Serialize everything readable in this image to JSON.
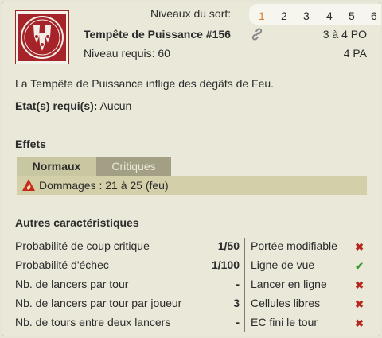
{
  "header": {
    "levels_label": "Niveaux du sort:",
    "levels": [
      "1",
      "2",
      "3",
      "4",
      "5",
      "6"
    ],
    "active_level": "1",
    "spell_name": "Tempête de Puissance #156",
    "range": "3 à 4 PO",
    "level_required": "Niveau requis: 60",
    "ap_cost": "4 PA"
  },
  "description": "La Tempête de Puissance inflige des dégâts de Feu.",
  "states": {
    "label": "Etat(s) requi(s):",
    "value": "Aucun"
  },
  "effects": {
    "title": "Effets",
    "tabs": [
      "Normaux",
      "Critiques"
    ],
    "active_tab": "Normaux",
    "rows": [
      "Dommages : 21 à 25 (feu)"
    ]
  },
  "other": {
    "title": "Autres caractéristiques",
    "left": [
      {
        "label": "Probabilité de coup critique",
        "value": "1/50"
      },
      {
        "label": "Probabilité d'échec",
        "value": "1/100"
      },
      {
        "label": "Nb. de lancers par tour",
        "value": "-"
      },
      {
        "label": "Nb. de lancers par tour par joueur",
        "value": "3"
      },
      {
        "label": "Nb. de tours entre deux lancers",
        "value": "-"
      }
    ],
    "right": [
      {
        "label": "Portée modifiable",
        "mark": "✖",
        "status": "no"
      },
      {
        "label": "Ligne de vue",
        "mark": "✔",
        "status": "yes"
      },
      {
        "label": "Lancer en ligne",
        "mark": "✖",
        "status": "no"
      },
      {
        "label": "Cellules libres",
        "mark": "✖",
        "status": "no"
      },
      {
        "label": "EC fini le tour",
        "mark": "✖",
        "status": "no"
      }
    ]
  },
  "colors": {
    "accent": "#e17a2d",
    "spell_icon": "#a6232a",
    "no": "#b6261e",
    "yes": "#2e9a2e"
  },
  "icons": {
    "spell": "spell-icon",
    "link": "link-icon",
    "fire": "fire-icon"
  }
}
